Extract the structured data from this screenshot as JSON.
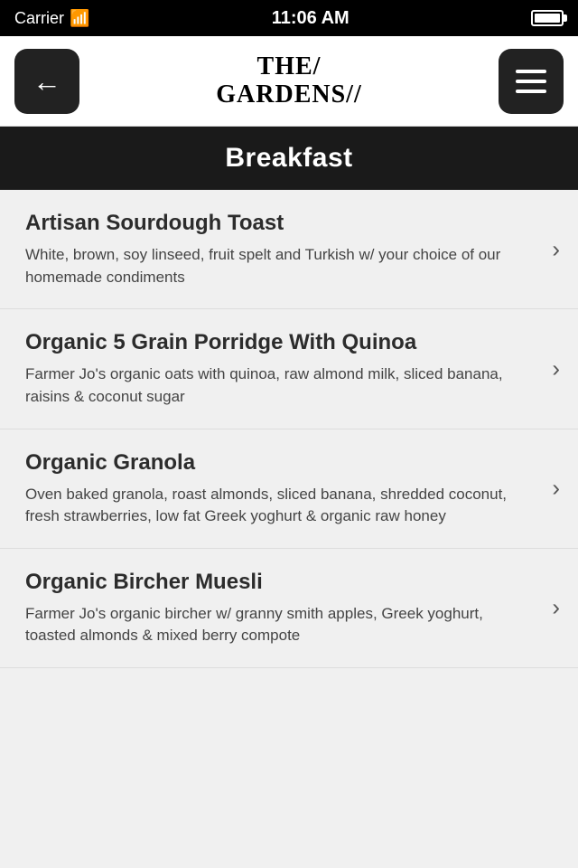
{
  "statusBar": {
    "carrier": "Carrier",
    "wifi": "wifi",
    "time": "11:06 AM",
    "battery": "battery"
  },
  "navBar": {
    "backLabel": "←",
    "logoLine1": "THE/",
    "logoLine2": "GARDENS//",
    "menuLabel": "menu"
  },
  "sectionHeader": {
    "title": "Breakfast"
  },
  "menuItems": [
    {
      "title": "Artisan Sourdough Toast",
      "description": "White, brown, soy linseed, fruit spelt and Turkish w/ your choice of our homemade condiments"
    },
    {
      "title": "Organic 5 Grain Porridge With Quinoa",
      "description": "Farmer Jo's organic oats with quinoa, raw almond milk, sliced banana, raisins & coconut sugar"
    },
    {
      "title": "Organic Granola",
      "description": "Oven baked granola, roast almonds, sliced banana, shredded coconut, fresh strawberries, low fat Greek yoghurt & organic raw honey"
    },
    {
      "title": "Organic Bircher Muesli",
      "description": "Farmer Jo's organic bircher w/ granny smith apples, Greek yoghurt, toasted almonds & mixed berry compote"
    }
  ]
}
